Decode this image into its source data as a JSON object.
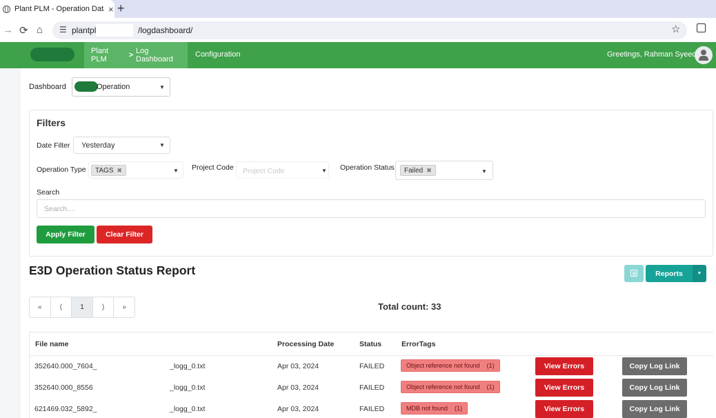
{
  "browser": {
    "tab_title": "Plant PLM - Operation Data Analysis",
    "tab_close": "×",
    "new_tab": "+",
    "url_prefix": "plantplm",
    "url_suffix": "/logdashboard/"
  },
  "header": {
    "breadcrumb_app": "Plant PLM",
    "breadcrumb_page": "Log Dashboard",
    "nav_config": "Configuration",
    "greeting": "Greetings, Rahman Syeedur"
  },
  "dashboard": {
    "label": "Dashboard",
    "selected": "Operation"
  },
  "filters": {
    "title": "Filters",
    "date_filter_label": "Date Filter",
    "date_filter_value": "Yesterday",
    "operation_type_label": "Operation Type",
    "operation_type_chip": "TAGS",
    "project_code_label": "Project Code",
    "project_code_placeholder": "Project Code",
    "operation_status_label": "Operation Status",
    "operation_status_chip": "Failed",
    "search_label": "Search",
    "search_placeholder": "Search....",
    "apply_label": "Apply Filter",
    "clear_label": "Clear Filter"
  },
  "report": {
    "title": "E3D Operation Status Report",
    "reports_label": "Reports",
    "pager": [
      "«",
      "(",
      "1",
      ")",
      "»"
    ],
    "total_count": "Total count: 33",
    "columns": [
      "File name",
      "Processing Date",
      "Status",
      "ErrorTags"
    ],
    "rows": [
      {
        "file_a": "352640.000_7604_",
        "file_b": "_logg_0.txt",
        "date": "Apr 03, 2024",
        "status": "FAILED",
        "tag": "Object reference not found",
        "tag_count": "(1)",
        "view_label": "View Errors",
        "copy_label": "Copy Log Link"
      },
      {
        "file_a": "352640.000_8556",
        "file_b": "_logg_0.txt",
        "date": "Apr 03, 2024",
        "status": "FAILED",
        "tag": "Object reference not found",
        "tag_count": "(1)",
        "view_label": "View Errors",
        "copy_label": "Copy Log Link"
      },
      {
        "file_a": "621469.032_5892_",
        "file_b": "_logg_0.txt",
        "date": "Apr 03, 2024",
        "status": "FAILED",
        "tag": "MDB not found",
        "tag_count": "(1)",
        "view_label": "View Errors",
        "copy_label": "Copy Log Link"
      }
    ]
  }
}
